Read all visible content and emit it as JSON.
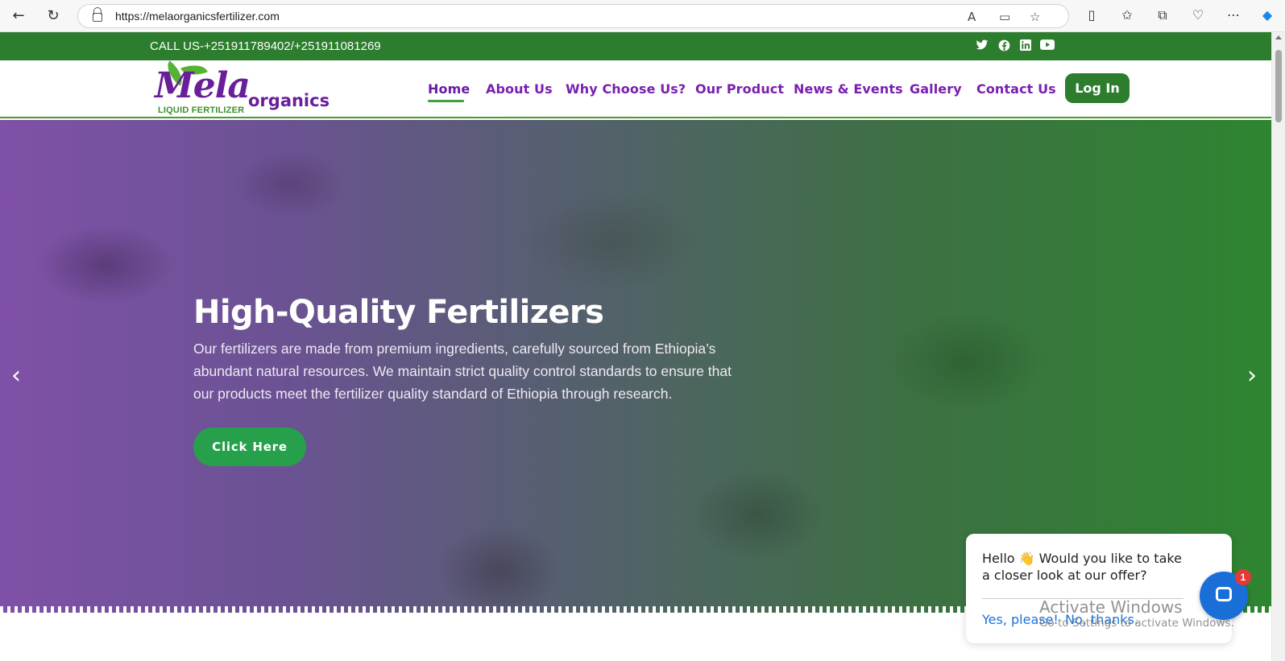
{
  "browser": {
    "url": "https://melaorganicsfertilizer.com",
    "icons": [
      "back-icon",
      "refresh-icon",
      "lock-icon",
      "read-aloud-icon",
      "immersive-reader-icon",
      "favorite-icon",
      "split-screen-icon",
      "favorites-icon",
      "collections-icon",
      "browser-essentials-icon",
      "more-icon",
      "copilot-icon"
    ]
  },
  "topbar": {
    "phone": "CALL US-+251911789402/+251911081269",
    "social": [
      "twitter-icon",
      "facebook-icon",
      "linkedin-icon",
      "youtube-icon"
    ]
  },
  "logo": {
    "mela": "Mela",
    "organics": "organics",
    "sub": "LIQUID FERTILIZER"
  },
  "nav": {
    "items": [
      "Home",
      "About Us",
      "Why Choose Us?",
      "Our Product",
      "News & Events",
      "Gallery",
      "Contact Us"
    ],
    "active": "Home",
    "login": "Log In"
  },
  "hero": {
    "title": "High-Quality Fertilizers",
    "text": "Our fertilizers are made from premium ingredients, carefully sourced from Ethiopia’s abundant natural resources. We maintain strict quality control standards to ensure that our products meet the fertilizer quality standard of Ethiopia through research.",
    "button": "Click Here"
  },
  "chat": {
    "message": "Hello 👋 Would you like to take a closer look at our offer?",
    "yes": "Yes, please!",
    "no": "No, thanks.",
    "badge": "1"
  },
  "watermark": {
    "title": "Activate Windows",
    "sub": "Go to Settings to activate Windows."
  },
  "colors": {
    "brand_green": "#2d7d2e",
    "brand_purple": "#7a1fb0",
    "cta_green": "#26a04a",
    "chat_blue": "#1a6ed8"
  }
}
